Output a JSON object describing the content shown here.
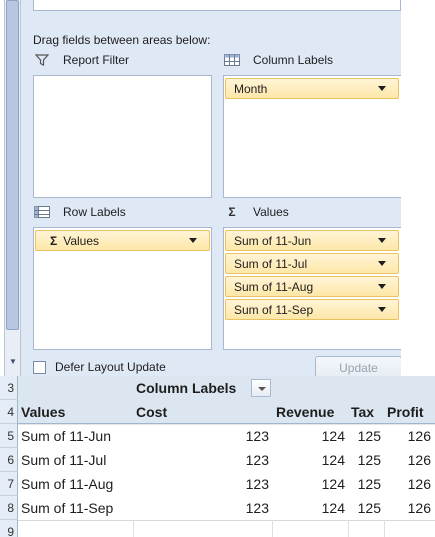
{
  "field_list": {
    "drag_hint": "Drag fields between areas below:",
    "report_filter": {
      "title": "Report Filter",
      "icon": "filter-icon",
      "fields": []
    },
    "column_labels": {
      "title": "Column Labels",
      "icon": "column-labels-icon",
      "fields": [
        "Month"
      ]
    },
    "row_labels": {
      "title": "Row Labels",
      "icon": "row-labels-icon",
      "fields": [
        "Values"
      ]
    },
    "values": {
      "title": "Values",
      "icon": "sigma-icon",
      "fields": [
        "Sum of 11-Jun",
        "Sum of 11-Jul",
        "Sum of 11-Aug",
        "Sum of 11-Sep"
      ]
    },
    "sigma": "Σ",
    "defer_label": "Defer Layout Update",
    "update_label": "Update"
  },
  "grid": {
    "row_numbers": [
      "3",
      "4",
      "5",
      "6",
      "7",
      "8",
      "9"
    ],
    "column_labels_text": "Column Labels",
    "headers": [
      "Values",
      "Cost",
      "Revenue",
      "Tax",
      "Profit"
    ],
    "rows": [
      {
        "label": "Sum of 11-Jun",
        "values": [
          "123",
          "124",
          "125",
          "126"
        ]
      },
      {
        "label": "Sum of 11-Jul",
        "values": [
          "123",
          "124",
          "125",
          "126"
        ]
      },
      {
        "label": "Sum of 11-Aug",
        "values": [
          "123",
          "124",
          "125",
          "126"
        ]
      },
      {
        "label": "Sum of 11-Sep",
        "values": [
          "123",
          "124",
          "125",
          "126"
        ]
      }
    ]
  },
  "colors": {
    "pane_bg": "#dfe8f5",
    "field_pill": "#fde7a8",
    "header_bg": "#dce6f1"
  }
}
